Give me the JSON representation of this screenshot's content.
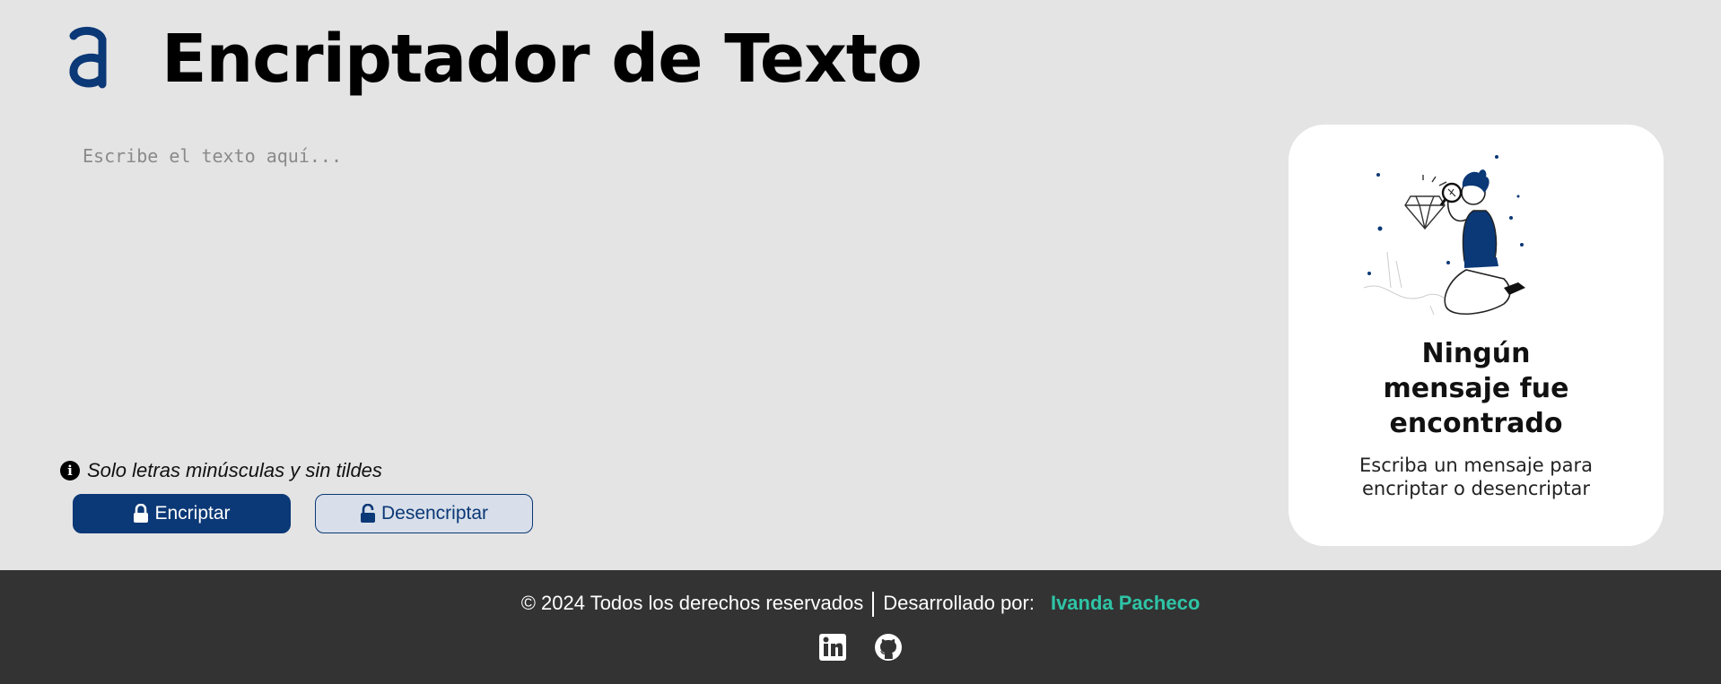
{
  "header": {
    "title": "Encriptador de Texto",
    "logo_icon": "alura-a-logo",
    "brand_color": "#0b3876"
  },
  "editor": {
    "value": "",
    "placeholder": "Escribe el texto aquí..."
  },
  "hint": {
    "icon": "info-icon",
    "text": "Solo letras minúsculas y sin tildes"
  },
  "buttons": {
    "encrypt_label": "Encriptar",
    "encrypt_icon": "lock-icon",
    "decrypt_label": "Desencriptar",
    "decrypt_icon": "unlock-icon"
  },
  "result_card": {
    "illustration": "person-with-magnifying-glass",
    "title_lines": [
      "Ningún",
      "mensaje fue",
      "encontrado"
    ],
    "subtitle_lines": [
      "Escriba un mensaje para",
      "encriptar o desencriptar"
    ]
  },
  "footer": {
    "copyright": "© 2024 Todos los derechos reservados",
    "developed_by": "Desarrollado por:",
    "author": "Ivanda Pacheco",
    "author_color": "#2ec4a6",
    "social_icons": [
      "linkedin-icon",
      "github-icon"
    ]
  }
}
